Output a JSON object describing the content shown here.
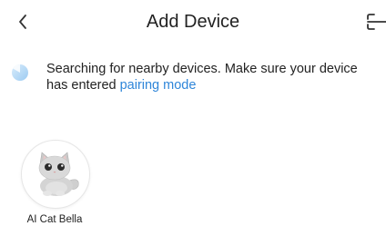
{
  "header": {
    "title": "Add Device",
    "back_icon": "chevron-left-icon",
    "scan_icon": "scan-icon"
  },
  "search": {
    "status_text": "Searching for nearby devices. Make sure your device has entered",
    "link_text": "pairing mode",
    "spinner_icon": "loading-spinner-icon",
    "accent_color": "#2f86d9"
  },
  "devices": [
    {
      "name": "AI Cat Bella",
      "image": "plush-cat-image"
    }
  ]
}
